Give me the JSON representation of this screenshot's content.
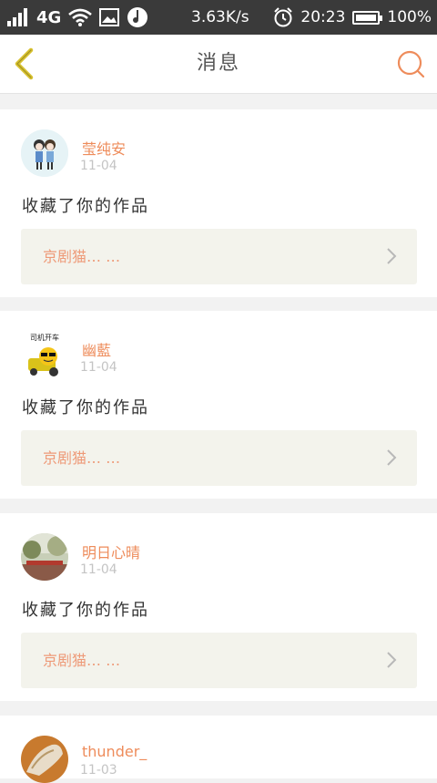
{
  "status_bar": {
    "carrier": "4G",
    "speed": "3.63K/s",
    "time": "20:23",
    "battery": "100%",
    "battery_level": 1.0
  },
  "header": {
    "title": "消息",
    "back_icon": "back-chevron-icon",
    "search_icon": "search-icon"
  },
  "colors": {
    "accent": "#ee8c5b",
    "back_icon": "#d8c230",
    "work_box_bg": "#f3f3ec"
  },
  "messages": [
    {
      "username": "莹纯安",
      "date": "11-04",
      "action": "收藏了你的作品",
      "work_title": "京剧猫…  …",
      "avatar_icon": "couple-cartoon-avatar"
    },
    {
      "username": "幽藍",
      "date": "11-04",
      "action": "收藏了你的作品",
      "work_title": "京剧猫…  …",
      "avatar_icon": "sunglasses-emoji-car-avatar",
      "avatar_caption": "司机开车"
    },
    {
      "username": "明日心晴",
      "date": "11-04",
      "action": "收藏了你的作品",
      "work_title": "京剧猫…  …",
      "avatar_icon": "scenery-photo-avatar"
    },
    {
      "username": "thunder_",
      "date": "11-03",
      "avatar_icon": "shoes-photo-avatar"
    }
  ]
}
